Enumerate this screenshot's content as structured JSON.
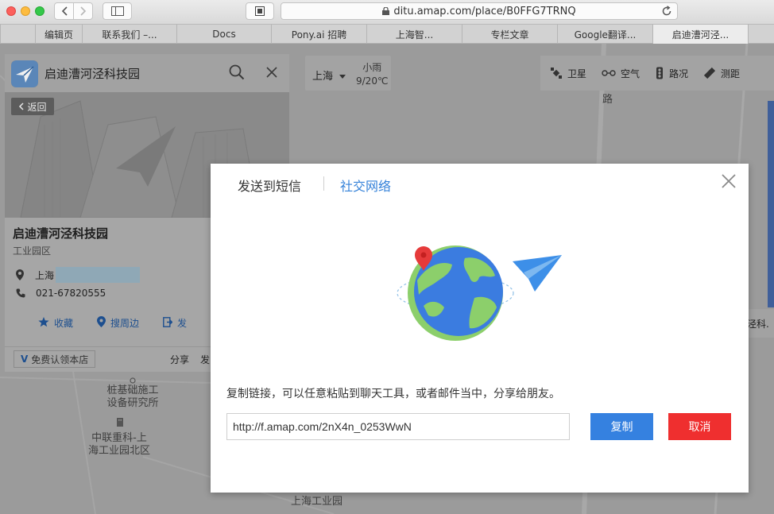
{
  "browser": {
    "url": "ditu.amap.com/place/B0FFG7TRNQ",
    "tabs": [
      {
        "label": "",
        "active": false
      },
      {
        "label": "编辑页",
        "active": false
      },
      {
        "label": "联系我们 –...",
        "active": false
      },
      {
        "label": "Docs",
        "active": false
      },
      {
        "label": "Pony.ai 招聘",
        "active": false
      },
      {
        "label": "上海智...",
        "active": false
      },
      {
        "label": "专栏文章",
        "active": false
      },
      {
        "label": "Google翻译...",
        "active": false
      },
      {
        "label": "启迪漕河泾...",
        "active": true
      },
      {
        "label": "",
        "active": false
      }
    ]
  },
  "search": {
    "title": "启迪漕河泾科技园"
  },
  "place": {
    "back_label": "返回",
    "name": "启迪漕河泾科技园",
    "category": "工业园区",
    "address_prefix": "上海",
    "phone": "021-67820555",
    "actions": [
      {
        "icon": "star-icon",
        "label": "收藏"
      },
      {
        "icon": "location-pin-icon",
        "label": "搜周边"
      },
      {
        "icon": "send-icon",
        "label": "发"
      }
    ],
    "claim_label": "免费认领本店",
    "share_label": "分享",
    "share_label2": "发"
  },
  "city": {
    "name": "上海",
    "weather": "小雨",
    "temperature": "9/20℃"
  },
  "toolbar": [
    {
      "icon": "satellite-icon",
      "label": "卫星"
    },
    {
      "icon": "air-icon",
      "label": "空气"
    },
    {
      "icon": "traffic-icon",
      "label": "路况"
    },
    {
      "icon": "ruler-icon",
      "label": "测距"
    }
  ],
  "map_labels": {
    "road": "路",
    "pile": "桩基础施工\n设备研究所",
    "zhonglian": "中联重科-上\n海工业园北区",
    "park": "上海工业园",
    "right_callout": "泾科."
  },
  "dialog": {
    "tab_sms": "发送到短信",
    "tab_social": "社交网络",
    "description": "复制链接，可以任意粘贴到聊天工具，或者邮件当中，分享给朋友。",
    "link": "http://f.amap.com/2nX4n_0253WwN",
    "copy_label": "复制",
    "cancel_label": "取消"
  },
  "colors": {
    "accent_blue": "#3581e0",
    "cancel_red": "#ef2f2f",
    "social_tab": "#3582d9"
  }
}
